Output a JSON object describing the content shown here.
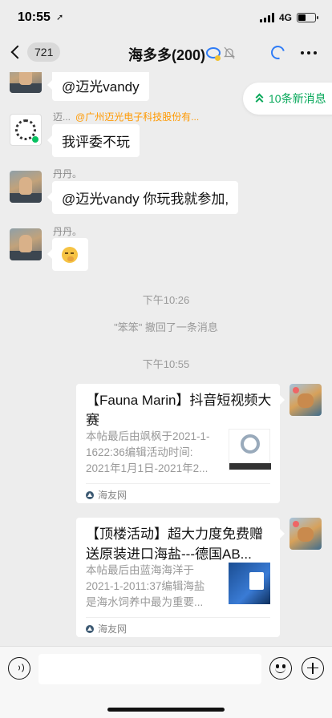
{
  "status": {
    "time": "10:55",
    "network": "4G",
    "battery_level": 0.45
  },
  "nav": {
    "back_count": "721",
    "title": "海多多(200)"
  },
  "new_messages": {
    "label": "10条新消息"
  },
  "messages": [
    {
      "text": "@迈光vandy"
    },
    {
      "sender": "迈...",
      "sender_org": "@广州迈光电子科技股份有...",
      "text": "我评委不玩"
    },
    {
      "sender": "丹丹。",
      "text": "@迈光vandy 你玩我就参加,"
    },
    {
      "sender": "丹丹。",
      "emoji": "thinking-face"
    }
  ],
  "system": {
    "time1": "下午10:26",
    "recall": "\"笨笨\" 撤回了一条消息",
    "time2": "下午10:55"
  },
  "cards": [
    {
      "title": "【Fauna Marin】抖音短视频大赛",
      "desc": [
        "本帖最后由飒枫于2021-1-",
        "1622:36编辑活动时间:",
        "2021年1月1日-2021年2..."
      ],
      "source": "海友网"
    },
    {
      "title": "【顶楼活动】超大力度免费赠送原装进口海盐---德国AB...",
      "desc": [
        "本帖最后由蓝海海洋于",
        "2021-1-2011:37编辑海盐",
        "是海水饲养中最为重要..."
      ],
      "source": "海友网"
    }
  ],
  "input": {
    "value": ""
  }
}
